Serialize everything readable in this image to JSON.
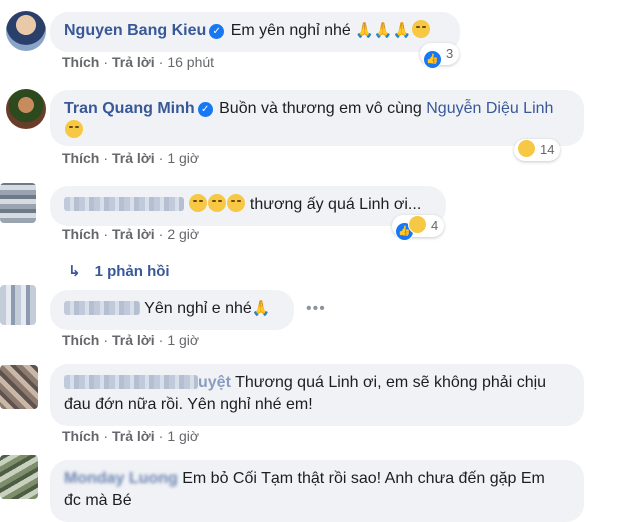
{
  "comments": [
    {
      "author": "Nguyen Bang Kieu",
      "text": "Em yên nghỉ nhé",
      "like": "Thích",
      "reply": "Trả lời",
      "time": "16 phút",
      "reactions": "3"
    },
    {
      "author": "Tran Quang Minh",
      "text": "Buồn và thương em vô cùng",
      "mention": "Nguyễn Diệu Linh",
      "like": "Thích",
      "reply": "Trả lời",
      "time": "1 giờ",
      "reactions": "14"
    },
    {
      "text": "thương ấy quá Linh ơi...",
      "like": "Thích",
      "reply": "Trả lời",
      "time": "2 giờ",
      "reactions": "4",
      "replies_label": "1 phản hồi"
    },
    {
      "text": "Yên nghỉ e nhé",
      "like": "Thích",
      "reply": "Trả lời",
      "time": "1 giờ"
    },
    {
      "author_partial": "uyệt",
      "text": "Thương quá Linh ơi, em sẽ không phải chịu",
      "text2": "đau đớn nữa rồi. Yên nghỉ nhé em!",
      "like": "Thích",
      "reply": "Trả lời",
      "time": "1 giờ"
    },
    {
      "author": "Monday Luong",
      "text": "Em bỏ Cối Tạm thật rồi sao! Anh chưa đến gặp Em",
      "text2": "đc mà Bé"
    }
  ]
}
